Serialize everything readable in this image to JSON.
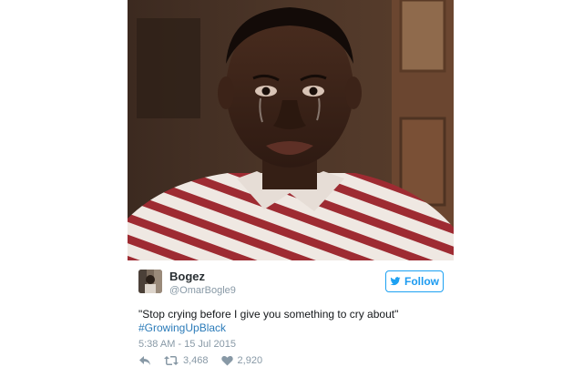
{
  "tweet": {
    "display_name": "Bogez",
    "handle": "@OmarBogle9",
    "follow_label": "Follow",
    "text": "\"Stop crying before I give you something to cry about\"",
    "hashtag": "#GrowingUpBlack",
    "timestamp": "5:38 AM - 15 Jul 2015",
    "retweets": "3,468",
    "likes": "2,920"
  },
  "colors": {
    "accent": "#1da1f2",
    "link": "#2b7bb9",
    "meta": "#8899a6"
  },
  "icons": {
    "reply": "reply-icon",
    "retweet": "retweet-icon",
    "like": "heart-icon",
    "follow": "bird-icon"
  }
}
